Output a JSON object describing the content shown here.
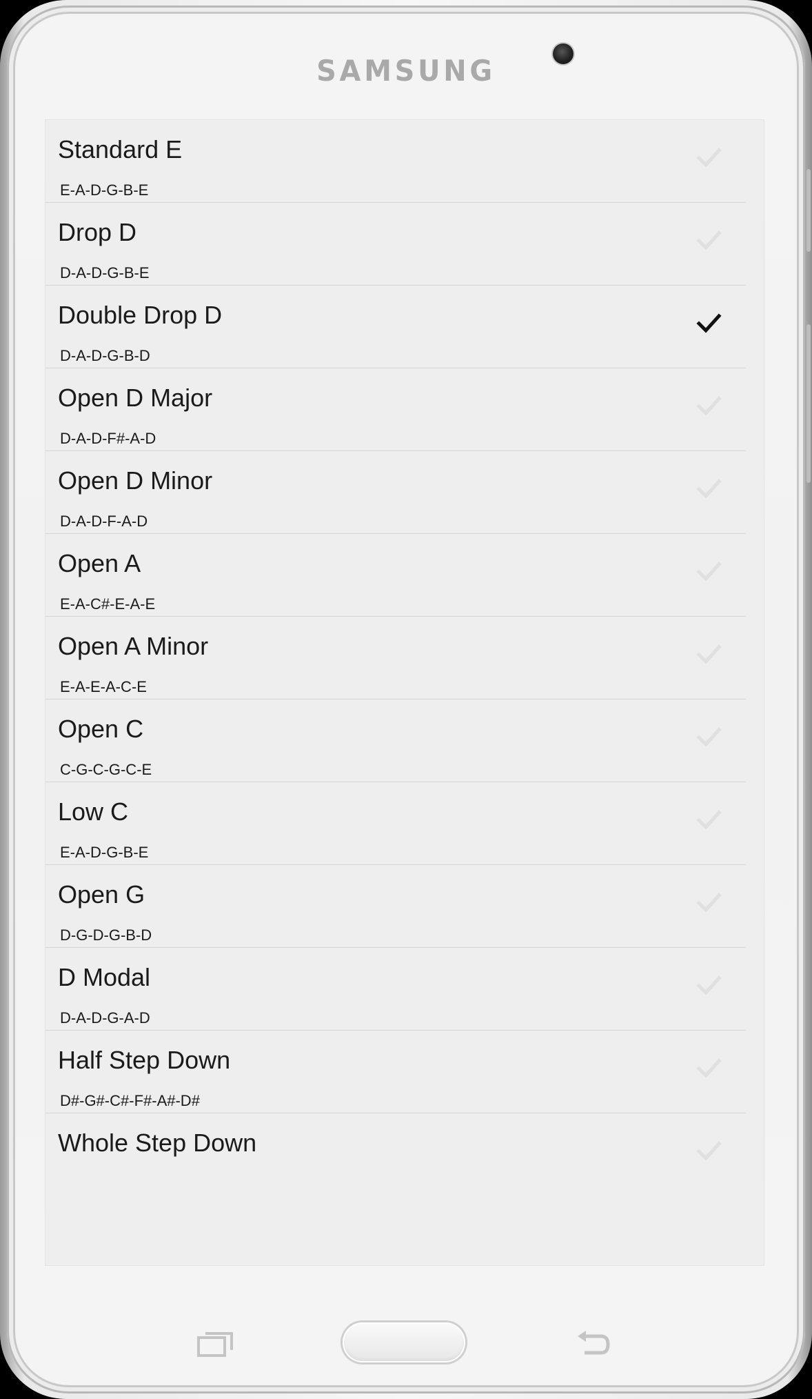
{
  "device": {
    "brand": "SAMSUNG"
  },
  "tunings": [
    {
      "name": "Standard E",
      "notes": "E-A-D-G-B-E",
      "selected": false
    },
    {
      "name": "Drop D",
      "notes": "D-A-D-G-B-E",
      "selected": false
    },
    {
      "name": "Double Drop D",
      "notes": "D-A-D-G-B-D",
      "selected": true
    },
    {
      "name": "Open D Major",
      "notes": "D-A-D-F#-A-D",
      "selected": false
    },
    {
      "name": "Open D Minor",
      "notes": "D-A-D-F-A-D",
      "selected": false
    },
    {
      "name": "Open A",
      "notes": "E-A-C#-E-A-E",
      "selected": false
    },
    {
      "name": "Open A Minor",
      "notes": "E-A-E-A-C-E",
      "selected": false
    },
    {
      "name": "Open C",
      "notes": "C-G-C-G-C-E",
      "selected": false
    },
    {
      "name": "Low C",
      "notes": "E-A-D-G-B-E",
      "selected": false
    },
    {
      "name": "Open G",
      "notes": "D-G-D-G-B-D",
      "selected": false
    },
    {
      "name": "D Modal",
      "notes": "D-A-D-G-A-D",
      "selected": false
    },
    {
      "name": "Half Step Down",
      "notes": "D#-G#-C#-F#-A#-D#",
      "selected": false
    },
    {
      "name": "Whole Step Down",
      "notes": "",
      "selected": false
    }
  ],
  "icons": {
    "check": "checkmark-icon",
    "recent": "recent-apps-icon",
    "home": "home-button",
    "back": "back-icon"
  },
  "colors": {
    "screen_bg": "#eeeeee",
    "text": "#1a1a1a",
    "check_on": "#111111",
    "check_off": "#e0e0e0"
  }
}
